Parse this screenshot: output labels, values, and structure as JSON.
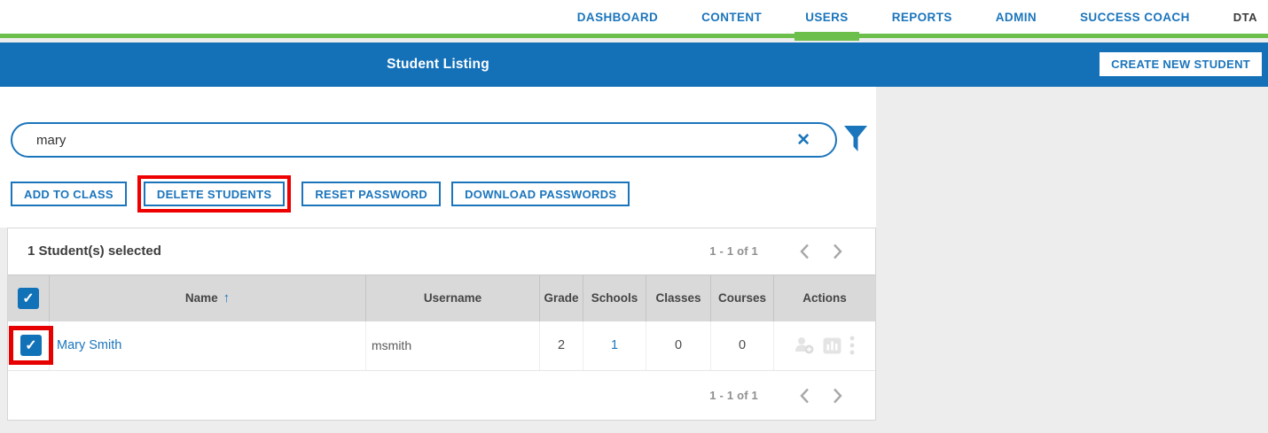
{
  "nav": {
    "items": [
      {
        "label": "DASHBOARD",
        "active": false
      },
      {
        "label": "CONTENT",
        "active": false
      },
      {
        "label": "USERS",
        "active": true
      },
      {
        "label": "REPORTS",
        "active": false
      },
      {
        "label": "ADMIN",
        "active": false
      },
      {
        "label": "SUCCESS COACH",
        "active": false
      }
    ],
    "user_badge": "DTA"
  },
  "header": {
    "title": "Student Listing",
    "create_button_label": "CREATE NEW STUDENT"
  },
  "search": {
    "value": "mary"
  },
  "toolbar": {
    "buttons": [
      "ADD TO CLASS",
      "DELETE STUDENTS",
      "RESET PASSWORD",
      "DOWNLOAD PASSWORDS"
    ]
  },
  "table": {
    "selected_summary": "1 Student(s) selected",
    "pagination": {
      "range_label": "1 - 1 of 1"
    },
    "columns": [
      "Name",
      "Username",
      "Grade",
      "Schools",
      "Classes",
      "Courses",
      "Actions"
    ],
    "sort": {
      "column": "Name",
      "direction": "asc"
    },
    "rows": [
      {
        "name": "Mary Smith",
        "username": "msmith",
        "grade": "2",
        "schools": "1",
        "classes": "0",
        "courses": "0",
        "selected": true
      }
    ]
  },
  "icons": {
    "check": "✓",
    "clear": "✕",
    "sort_asc": "↑",
    "filter": "funnel-icon",
    "chevron_left": "chevron-left-icon",
    "chevron_right": "chevron-right-icon",
    "row_actions": [
      "add-to-class-icon",
      "report-icon",
      "more-options-icon"
    ]
  },
  "colors": {
    "brand_blue": "#1471b8",
    "link_blue": "#1b75bc",
    "accent_green": "#6cbf4a",
    "annotation_red": "#ee0000",
    "table_header_bg": "#d9d9d9"
  },
  "annotations": {
    "highlighted_button": "DELETE STUDENTS",
    "highlighted_checkbox_row": "Mary Smith"
  }
}
